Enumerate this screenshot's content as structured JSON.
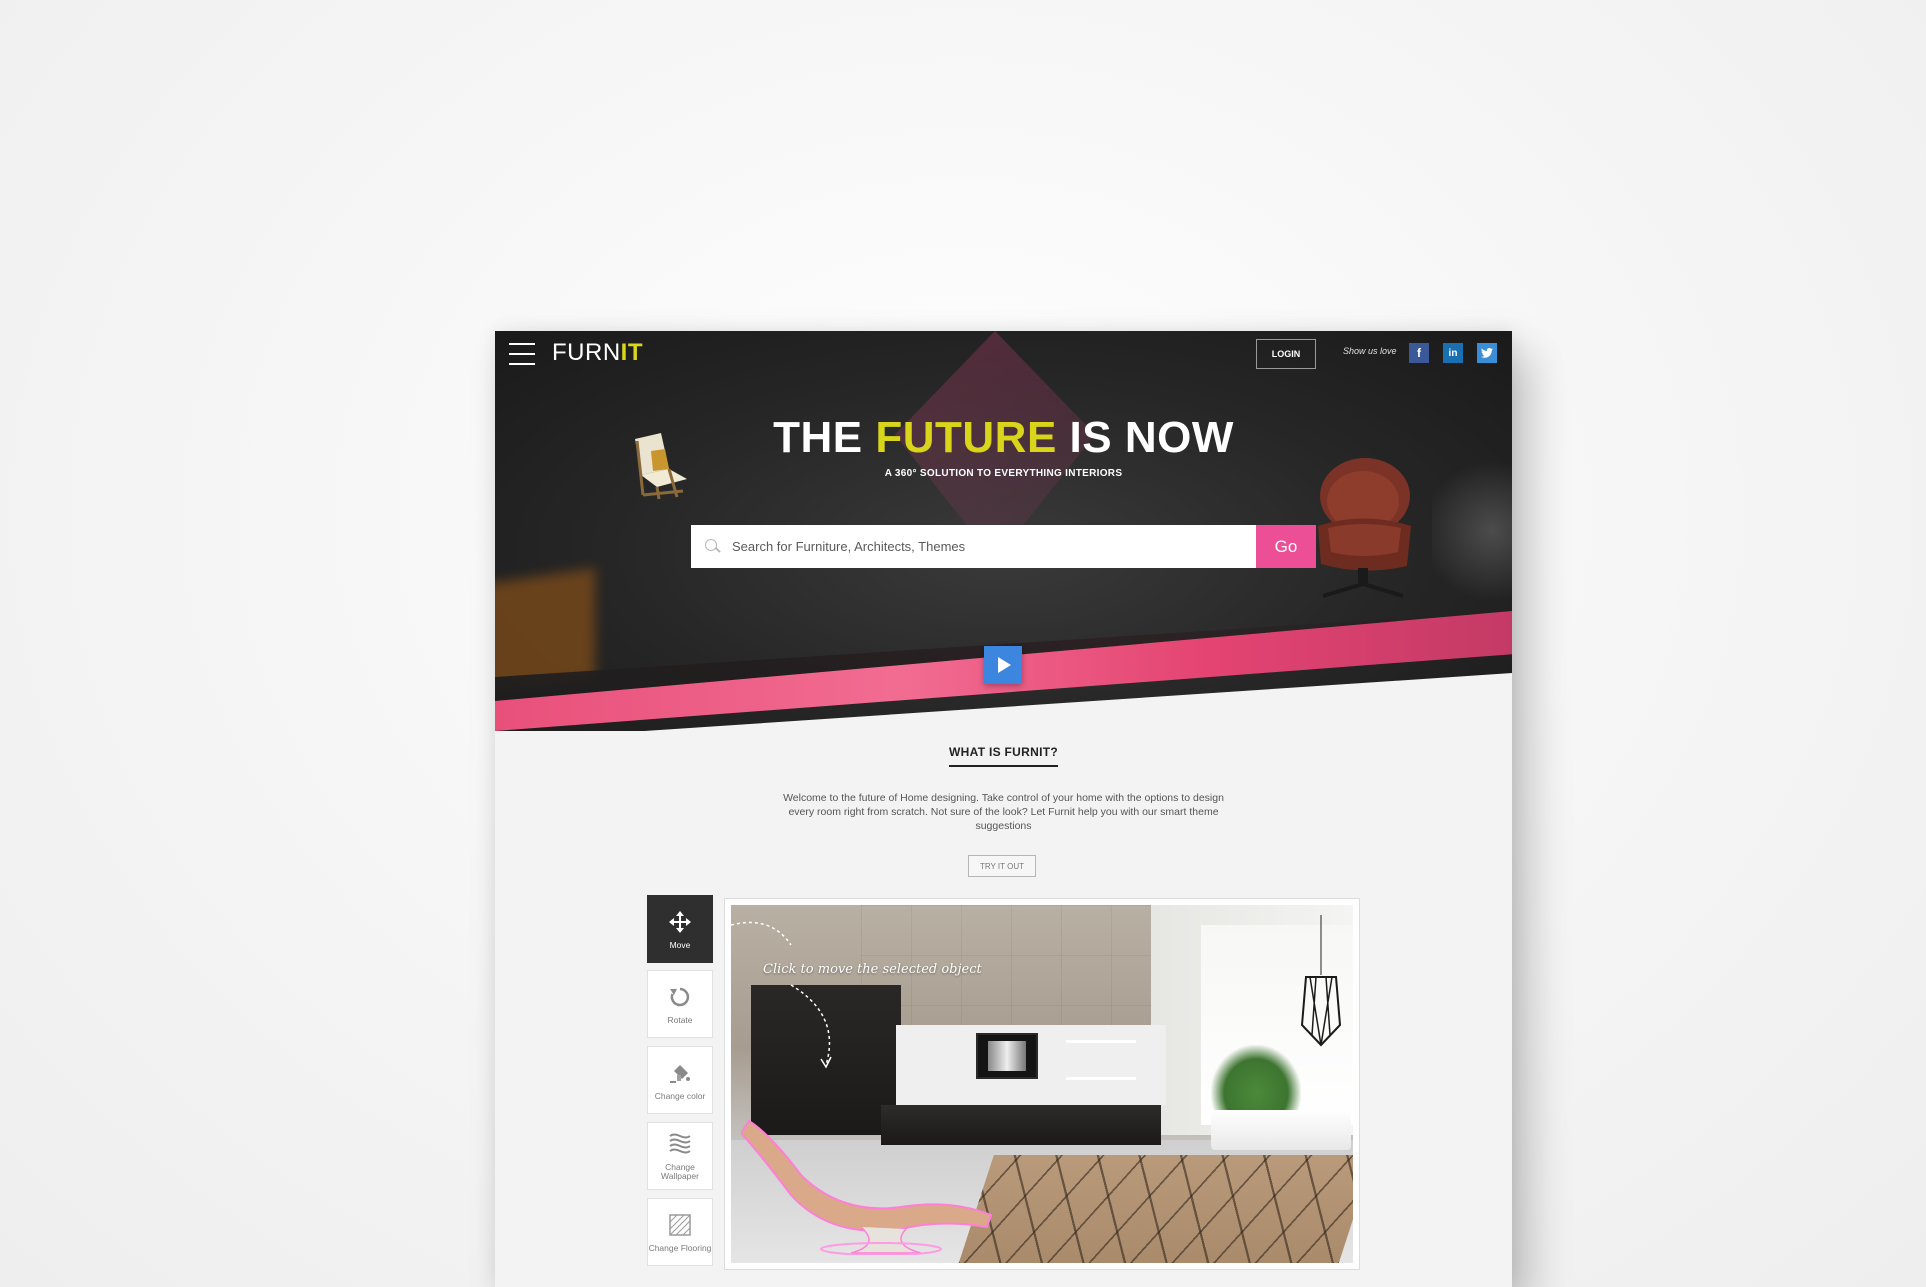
{
  "nav": {
    "brand_prefix": "FURN",
    "brand_accent": "IT",
    "login_label": "LOGIN",
    "social_label": "Show us love",
    "social": [
      {
        "name": "facebook-icon",
        "glyph": "f"
      },
      {
        "name": "linkedin-icon",
        "glyph": "in"
      },
      {
        "name": "twitter-icon",
        "glyph": "t"
      }
    ]
  },
  "hero": {
    "title_part1": "THE ",
    "title_accent": "FUTURE",
    "title_part2": " IS NOW",
    "subtitle": "A 360° SOLUTION TO EVERYTHING INTERIORS",
    "search_placeholder": "Search for Furniture, Architects, Themes",
    "go_label": "Go"
  },
  "about": {
    "title": "WHAT IS FURNIT?",
    "text": "Welcome to the future of Home designing. Take control of your home with the options to design every room right from scratch. Not sure of the look? Let Furnit help you with our smart theme suggestions",
    "try_label": "TRY IT OUT"
  },
  "tools": [
    {
      "label": "Move",
      "icon": "move-arrows-icon",
      "active": true
    },
    {
      "label": "Rotate",
      "icon": "rotate-icon",
      "active": false
    },
    {
      "label": "Change color",
      "icon": "paint-bucket-icon",
      "active": false
    },
    {
      "label": "Change Wallpaper",
      "icon": "wallpaper-icon",
      "active": false
    },
    {
      "label": "Change Flooring",
      "icon": "flooring-icon",
      "active": false
    }
  ],
  "preview": {
    "hint": "Click to move the selected object"
  },
  "colors": {
    "accent_yellow": "#d8d51a",
    "accent_pink": "#ec4f95",
    "play_blue": "#3d86e0"
  }
}
